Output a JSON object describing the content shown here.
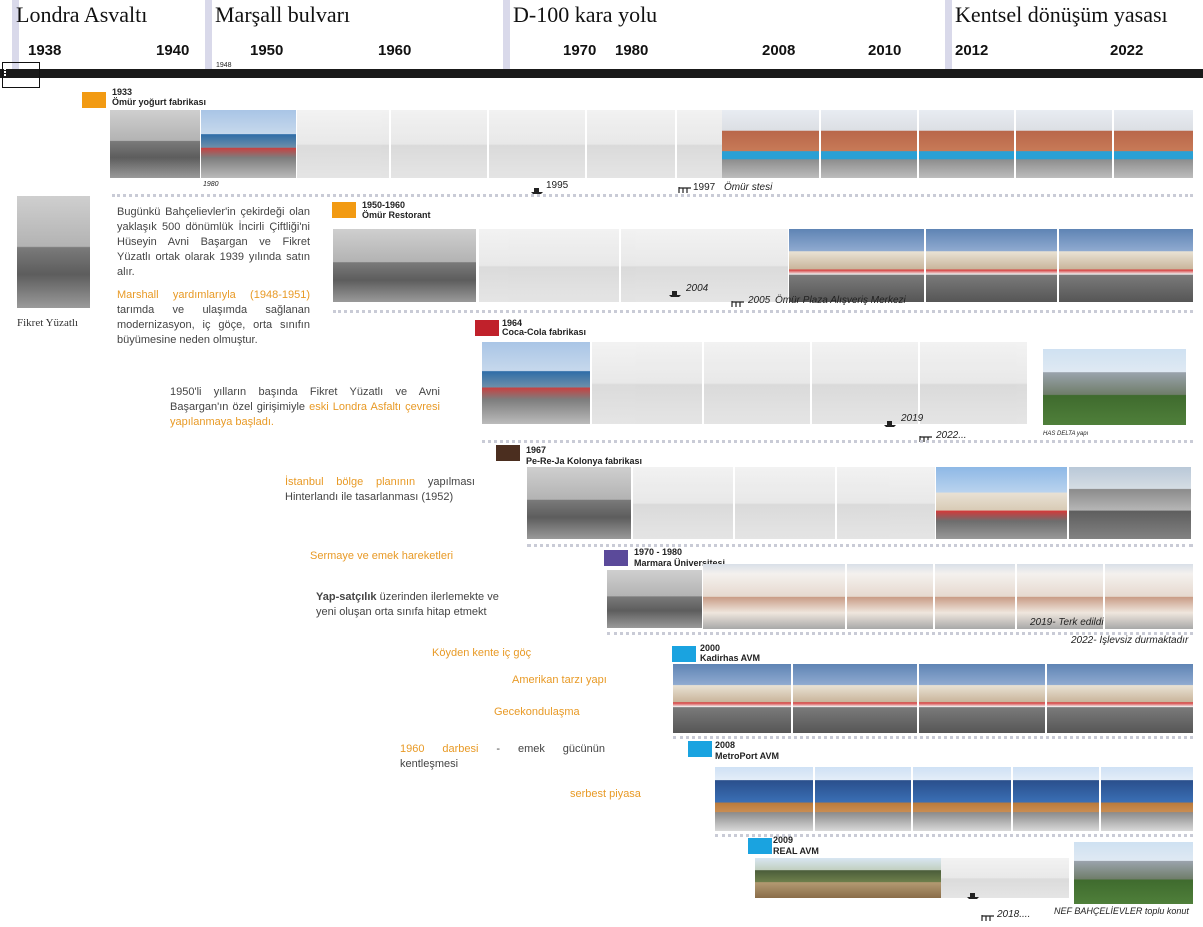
{
  "eras": [
    "Londra Asvaltı",
    "Marşall bulvarı",
    "D-100 kara yolu",
    "Kentsel dönüşüm yasası"
  ],
  "years": [
    "1938",
    "1940",
    "1950",
    "1960",
    "1970",
    "1980",
    "2008",
    "2010",
    "2012",
    "2022"
  ],
  "small_year": "1948",
  "colors": {
    "orange": "#f29a12",
    "red": "#c0212b",
    "brown": "#4b2e1f",
    "purple": "#5b4a9a",
    "blue": "#1aa3e0",
    "axis": "#1a1a1a",
    "era_bar": "#d9d9ea"
  },
  "events": [
    {
      "year": "1933",
      "name": "Ömür yoğurt fabrikası",
      "color": "orange",
      "captions": [
        "1980",
        "1995",
        "1997",
        "Ömür stesi"
      ]
    },
    {
      "year": "1950-1960",
      "name": "Ömür Restorant",
      "color": "orange",
      "captions": [
        "2004",
        "2005",
        "Ömür Plaza Alışveriş Merkezi"
      ]
    },
    {
      "year": "1964",
      "name": "Coca-Cola fabrikası",
      "color": "red",
      "captions": [
        "2019",
        "2022...",
        "HAS DELTA yapı"
      ]
    },
    {
      "year": "1967",
      "name": "Pe-Re-Ja Kolonya fabrikası",
      "color": "brown",
      "captions": []
    },
    {
      "year": "1970 - 1980",
      "name": "Marmara Üniversitesi",
      "color": "purple",
      "captions": [
        "2019- Terk edildi",
        "2022- İşlevsiz durmaktadır"
      ]
    },
    {
      "year": "2000",
      "name": "Kadirhas AVM",
      "color": "blue",
      "captions": []
    },
    {
      "year": "2008",
      "name": "MetroPort AVM",
      "color": "blue",
      "captions": []
    },
    {
      "year": "2009",
      "name": "REAL AVM",
      "color": "blue",
      "captions": [
        "2018....",
        "NEF BAHÇELİEVLER toplu konut"
      ]
    }
  ],
  "person": "Fikret Yüzatlı",
  "texts": {
    "p1": "Bugünkü Bahçelievler'in çekirdeği olan yaklaşık 500 dönümlük İncirli Çiftliği'ni Hüseyin Avni Başargan ve Fikret Yüzatlı ortak olarak 1939 yılında satın alır.",
    "p2_orange": "Marshall yardımlarıyla (1948-1951)",
    "p2_rest": " tarımda ve ulaşımda sağlanan modernizasyon, iç göçe, orta sınıfın büyümesine neden olmuştur.",
    "p3_gray": "1950'li yılların başında Fikret Yüzatlı ve Avni Başargan'ın özel girişimiyle ",
    "p3_orange": "eski Londra Asfaltı çevresi yapılanmaya başladı.",
    "p4_orange": "İstanbul bölge planının",
    "p4_rest": " yapılması Hinterlandı ile tasarlanması (1952)",
    "p5": "Sermaye ve emek hareketleri",
    "p6_bold": "Yap-satçılık",
    "p6_rest": " üzerinden ilerlemekte ve yeni oluşan orta sınıfa hitap etmekt",
    "p7": "Köyden kente iç göç",
    "p8": "Amerikan tarzı yapı",
    "p9": "Gecekondulaşma",
    "p10_orange": "1960 darbesi",
    "p10_rest": " - emek gücünün kentleşmesi",
    "p11": "serbest piyasa"
  }
}
